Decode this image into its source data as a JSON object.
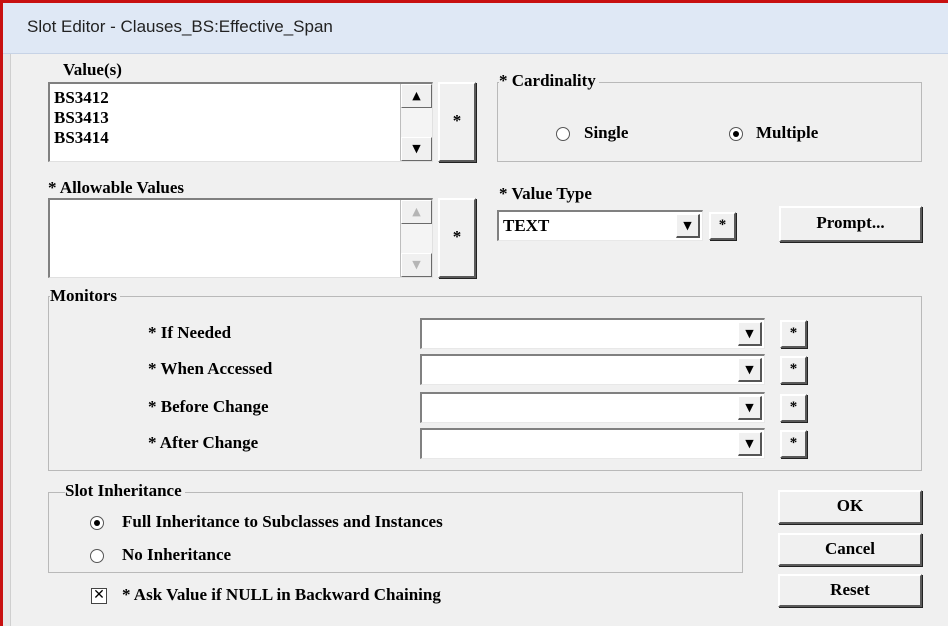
{
  "window": {
    "title": "Slot Editor - Clauses_BS:Effective_Span"
  },
  "values": {
    "label": "Value(s)",
    "items": [
      "BS3412",
      "BS3413",
      "BS3414"
    ],
    "star_button": "*"
  },
  "allowable": {
    "label": "* Allowable Values",
    "star_button": "*"
  },
  "cardinality": {
    "legend": "* Cardinality",
    "options": [
      "Single",
      "Multiple"
    ],
    "selected": "Multiple"
  },
  "value_type": {
    "label": "* Value Type",
    "selected": "TEXT",
    "star_button": "*",
    "prompt_button": "Prompt..."
  },
  "monitors": {
    "legend": "Monitors",
    "rows": [
      {
        "label": "* If Needed",
        "value": "",
        "star": "*"
      },
      {
        "label": "* When Accessed",
        "value": "",
        "star": "*"
      },
      {
        "label": "* Before Change",
        "value": "",
        "star": "*"
      },
      {
        "label": "* After Change",
        "value": "",
        "star": "*"
      }
    ]
  },
  "inheritance": {
    "legend": "Slot Inheritance",
    "options": [
      "Full Inheritance to Subclasses and Instances",
      "No Inheritance"
    ],
    "selected": "Full Inheritance to Subclasses and Instances"
  },
  "ask_null": {
    "label": "* Ask Value if NULL in Backward Chaining",
    "checked": true,
    "mark": "✕"
  },
  "buttons": {
    "ok": "OK",
    "cancel": "Cancel",
    "reset": "Reset"
  },
  "icons": {
    "scroll_up": "up-arrow-icon",
    "scroll_down": "down-arrow-icon",
    "dropdown": "down-arrow-icon"
  }
}
